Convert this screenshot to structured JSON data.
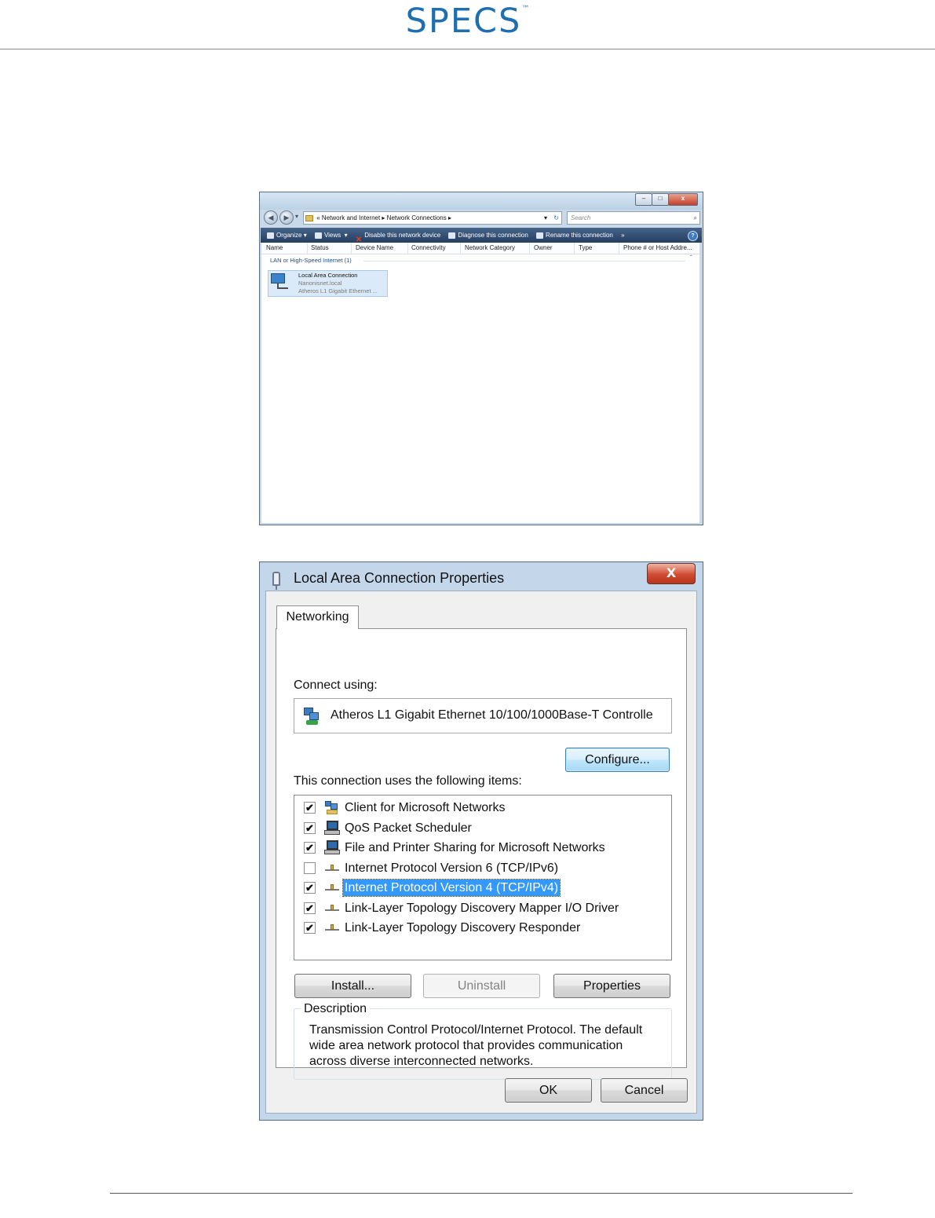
{
  "page": {
    "logo_text": "SPECS",
    "logo_tm": "™"
  },
  "explorer": {
    "window_buttons": {
      "minimize": "–",
      "maximize": "□",
      "close": "x"
    },
    "nav": {
      "back": "◀",
      "forward": "▶",
      "recent": "▾"
    },
    "address": {
      "prefix": "«",
      "crumbs": [
        "Network and Internet",
        "Network Connections"
      ],
      "separator": "▸",
      "dropdown": "▾",
      "refresh": "↻"
    },
    "search_placeholder": "Search",
    "search_icon": "⌕",
    "commands": {
      "organize": "Organize",
      "views": "Views",
      "disable": "Disable this network device",
      "diagnose": "Diagnose this connection",
      "rename": "Rename this connection",
      "more": "»",
      "help": "?"
    },
    "columns": [
      "Name",
      "Status",
      "Device Name",
      "Connectivity",
      "Network Category",
      "Owner",
      "Type",
      "Phone # or Host Addre..."
    ],
    "group": {
      "label": "LAN or High-Speed Internet (1)",
      "chevron": "ˆ"
    },
    "connection": {
      "name": "Local Area Connection",
      "network": "Nanonisnet.local",
      "device": "Atheros L1 Gigabit Ethernet ..."
    }
  },
  "dialog": {
    "title": "Local Area Connection Properties",
    "close": "X",
    "tab": "Networking",
    "connect_using_label": "Connect using:",
    "adapter": "Atheros L1 Gigabit Ethernet 10/100/1000Base-T Controlle",
    "configure_button": "Configure...",
    "items_label": "This connection uses the following items:",
    "items": [
      {
        "label": "Client for Microsoft Networks",
        "checked": "✔",
        "icon": "client-icon"
      },
      {
        "label": "QoS Packet Scheduler",
        "checked": "✔",
        "icon": "computer-icon"
      },
      {
        "label": "File and Printer Sharing for Microsoft Networks",
        "checked": "✔",
        "icon": "computer-icon"
      },
      {
        "label": "Internet Protocol Version 6 (TCP/IPv6)",
        "checked": "",
        "icon": "protocol-icon"
      },
      {
        "label": "Internet Protocol Version 4 (TCP/IPv4)",
        "checked": "✔",
        "icon": "protocol-icon",
        "selected": true
      },
      {
        "label": "Link-Layer Topology Discovery Mapper I/O Driver",
        "checked": "✔",
        "icon": "protocol-icon"
      },
      {
        "label": "Link-Layer Topology Discovery Responder",
        "checked": "✔",
        "icon": "protocol-icon"
      }
    ],
    "install_button": "Install...",
    "uninstall_button": "Uninstall",
    "properties_button": "Properties",
    "description_label": "Description",
    "description_text": "Transmission Control Protocol/Internet Protocol. The default wide area network protocol that provides communication across diverse interconnected networks.",
    "ok_button": "OK",
    "cancel_button": "Cancel"
  }
}
